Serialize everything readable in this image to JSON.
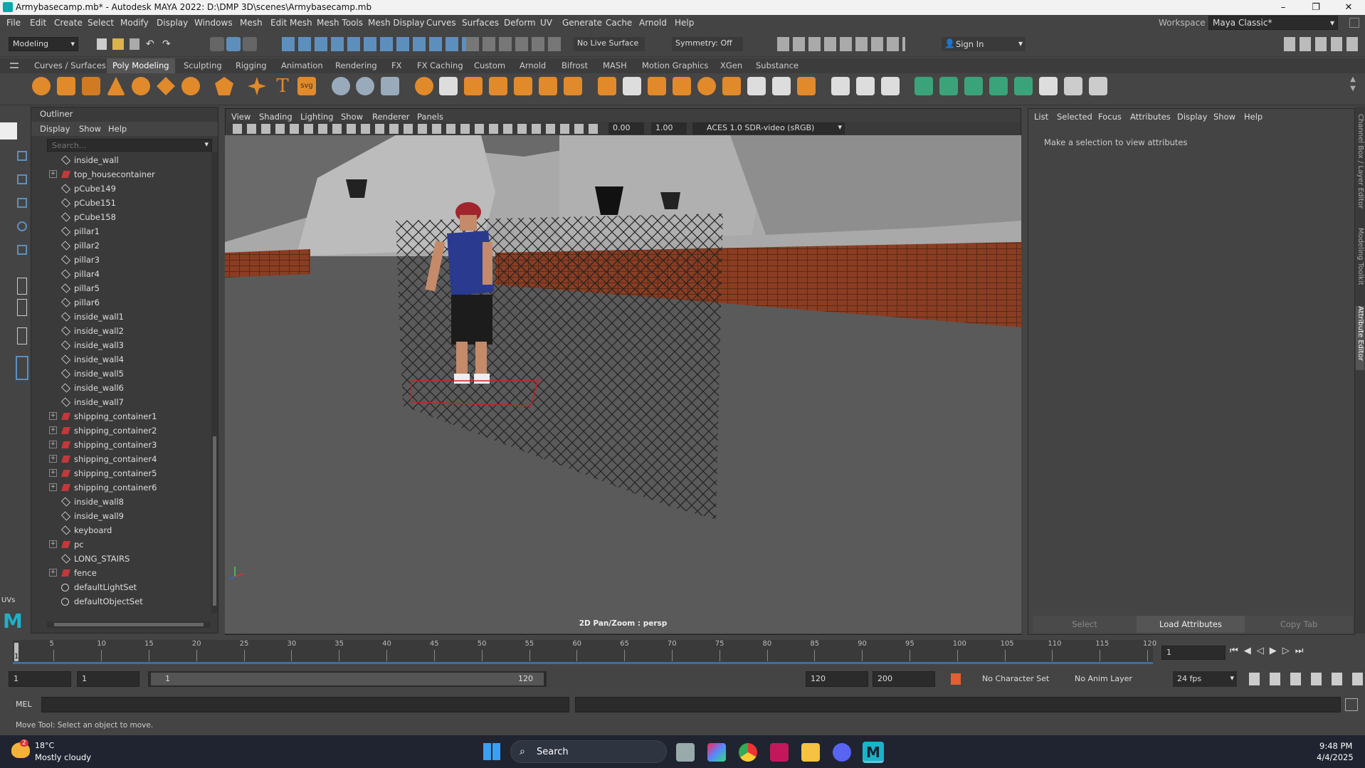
{
  "window": {
    "title": "Armybasecamp.mb* - Autodesk MAYA 2022: D:\\DMP 3D\\scenes\\Armybasecamp.mb",
    "min": "–",
    "max": "❐",
    "close": "✕"
  },
  "menus": [
    "File",
    "Edit",
    "Create",
    "Select",
    "Modify",
    "Display",
    "Windows",
    "Mesh",
    "Edit Mesh",
    "Mesh Tools",
    "Mesh Display",
    "Curves",
    "Surfaces",
    "Deform",
    "UV",
    "Generate",
    "Cache",
    "Arnold",
    "Help"
  ],
  "workspace": {
    "label": "Workspace :",
    "value": "Maya Classic*"
  },
  "status": {
    "mode": "Modeling",
    "live_surface": "No Live Surface",
    "symmetry": "Symmetry: Off",
    "sign_in": "Sign In"
  },
  "shelf_tabs": [
    "Curves / Surfaces",
    "Poly Modeling",
    "Sculpting",
    "Rigging",
    "Animation",
    "Rendering",
    "FX",
    "FX Caching",
    "Custom",
    "Arnold",
    "Bifrost",
    "MASH",
    "Motion Graphics",
    "XGen",
    "Substance"
  ],
  "shelf_active": "Poly Modeling",
  "outliner": {
    "title": "Outliner",
    "menu": [
      "Display",
      "Show",
      "Help"
    ],
    "search_placeholder": "Search...",
    "items": [
      {
        "label": "inside_wall",
        "type": "mesh",
        "expand": false
      },
      {
        "label": "top_housecontainer",
        "type": "group",
        "expand": true
      },
      {
        "label": "pCube149",
        "type": "mesh",
        "expand": false
      },
      {
        "label": "pCube151",
        "type": "mesh",
        "expand": false
      },
      {
        "label": "pCube158",
        "type": "mesh",
        "expand": false
      },
      {
        "label": "pillar1",
        "type": "mesh",
        "expand": false
      },
      {
        "label": "pillar2",
        "type": "mesh",
        "expand": false
      },
      {
        "label": "pillar3",
        "type": "mesh",
        "expand": false
      },
      {
        "label": "pillar4",
        "type": "mesh",
        "expand": false
      },
      {
        "label": "pillar5",
        "type": "mesh",
        "expand": false
      },
      {
        "label": "pillar6",
        "type": "mesh",
        "expand": false
      },
      {
        "label": "inside_wall1",
        "type": "mesh",
        "expand": false
      },
      {
        "label": "inside_wall2",
        "type": "mesh",
        "expand": false
      },
      {
        "label": "inside_wall3",
        "type": "mesh",
        "expand": false
      },
      {
        "label": "inside_wall4",
        "type": "mesh",
        "expand": false
      },
      {
        "label": "inside_wall5",
        "type": "mesh",
        "expand": false
      },
      {
        "label": "inside_wall6",
        "type": "mesh",
        "expand": false
      },
      {
        "label": "inside_wall7",
        "type": "mesh",
        "expand": false
      },
      {
        "label": "shipping_container1",
        "type": "group",
        "expand": true
      },
      {
        "label": "shipping_container2",
        "type": "group",
        "expand": true
      },
      {
        "label": "shipping_container3",
        "type": "group",
        "expand": true
      },
      {
        "label": "shipping_container4",
        "type": "group",
        "expand": true
      },
      {
        "label": "shipping_container5",
        "type": "group",
        "expand": true
      },
      {
        "label": "shipping_container6",
        "type": "group",
        "expand": true
      },
      {
        "label": "inside_wall8",
        "type": "mesh",
        "expand": false
      },
      {
        "label": "inside_wall9",
        "type": "mesh",
        "expand": false
      },
      {
        "label": "keyboard",
        "type": "mesh",
        "expand": false
      },
      {
        "label": "pc",
        "type": "group",
        "expand": true
      },
      {
        "label": "LONG_STAIRS",
        "type": "mesh",
        "expand": false
      },
      {
        "label": "fence",
        "type": "group",
        "expand": true
      },
      {
        "label": "defaultLightSet",
        "type": "set",
        "expand": false
      },
      {
        "label": "defaultObjectSet",
        "type": "set",
        "expand": false
      }
    ]
  },
  "viewport": {
    "menu": [
      "View",
      "Shading",
      "Lighting",
      "Show",
      "Renderer",
      "Panels"
    ],
    "exposure": "0.00",
    "gamma": "1.00",
    "colorspace": "ACES 1.0 SDR-video (sRGB)",
    "hud": "2D Pan/Zoom : persp"
  },
  "attribute_editor": {
    "menu": [
      "List",
      "Selected",
      "Focus",
      "Attributes",
      "Display",
      "Show",
      "Help"
    ],
    "message": "Make a selection to view attributes",
    "buttons": [
      "Select",
      "Load Attributes",
      "Copy Tab"
    ]
  },
  "side_tabs": [
    "Channel Box / Layer Editor",
    "Modeling Toolkit",
    "Attribute Editor"
  ],
  "timeline": {
    "ticks": [
      "5",
      "10",
      "15",
      "20",
      "25",
      "30",
      "35",
      "40",
      "45",
      "50",
      "55",
      "60",
      "65",
      "70",
      "75",
      "80",
      "85",
      "90",
      "95",
      "100",
      "105",
      "110",
      "115",
      "120"
    ],
    "current_frame": "1",
    "start_marker": "1"
  },
  "range": {
    "start": "1",
    "playback_start": "1",
    "slider_start": "1",
    "slider_end": "120",
    "playback_end": "120",
    "end": "200",
    "character_set": "No Character Set",
    "anim_layer": "No Anim Layer",
    "fps": "24 fps"
  },
  "command_line": {
    "label": "MEL"
  },
  "help_line": "Move Tool: Select an object to move.",
  "toolbox_label": "UVs",
  "taskbar": {
    "weather_temp": "18°C",
    "weather_desc": "Mostly cloudy",
    "weather_badge": "2",
    "search": "Search",
    "time": "9:48 PM",
    "date": "4/4/2025"
  }
}
